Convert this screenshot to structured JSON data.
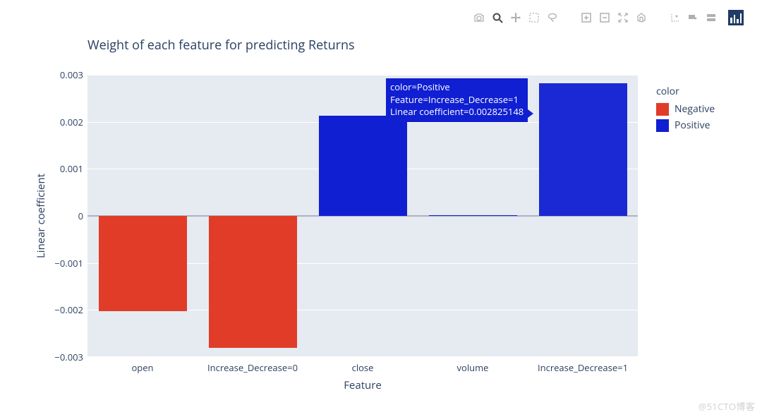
{
  "title": "Weight of each feature for predicting Returns",
  "xaxis_title": "Feature",
  "yaxis_title": "Linear coefficient",
  "legend": {
    "title": "color",
    "items": [
      {
        "label": "Negative"
      },
      {
        "label": "Positive"
      }
    ]
  },
  "yticks": [
    "−0.003",
    "−0.002",
    "−0.001",
    "0",
    "0.001",
    "0.002",
    "0.003"
  ],
  "xticks": [
    "open",
    "Increase_Decrease=0",
    "close",
    "volume",
    "Increase_Decrease=1"
  ],
  "tooltip": {
    "line1": "color=Positive",
    "line2": "Feature=Increase_Decrease=1",
    "line3": "Linear coefficient=0.002825148"
  },
  "watermark": "@51CTO博客",
  "modebar": {
    "camera": "camera-icon",
    "zoom": "zoom-icon",
    "pan": "pan-icon",
    "select": "box-select-icon",
    "lasso": "lasso-icon",
    "zoomin": "zoom-in-icon",
    "zoomout": "zoom-out-icon",
    "autoscale": "autoscale-icon",
    "reset": "reset-axes-icon",
    "spike": "spikelines-icon",
    "tag": "hoverclosest-icon",
    "compare": "hovercompare-icon",
    "plotly": "plotly-logo"
  },
  "chart_data": {
    "type": "bar",
    "title": "Weight of each feature for predicting Returns",
    "xlabel": "Feature",
    "ylabel": "Linear coefficient",
    "ylim": [
      -0.003,
      0.003
    ],
    "categories": [
      "open",
      "Increase_Decrease=0",
      "close",
      "volume",
      "Increase_Decrease=1"
    ],
    "series": [
      {
        "name": "Negative",
        "color": "#e13c28",
        "values": [
          -0.00203,
          -0.00281,
          null,
          null,
          null
        ]
      },
      {
        "name": "Positive",
        "color": "#0f1fd1",
        "values": [
          null,
          null,
          0.00213,
          0.0,
          0.002825148
        ]
      }
    ],
    "legend_title": "color"
  }
}
